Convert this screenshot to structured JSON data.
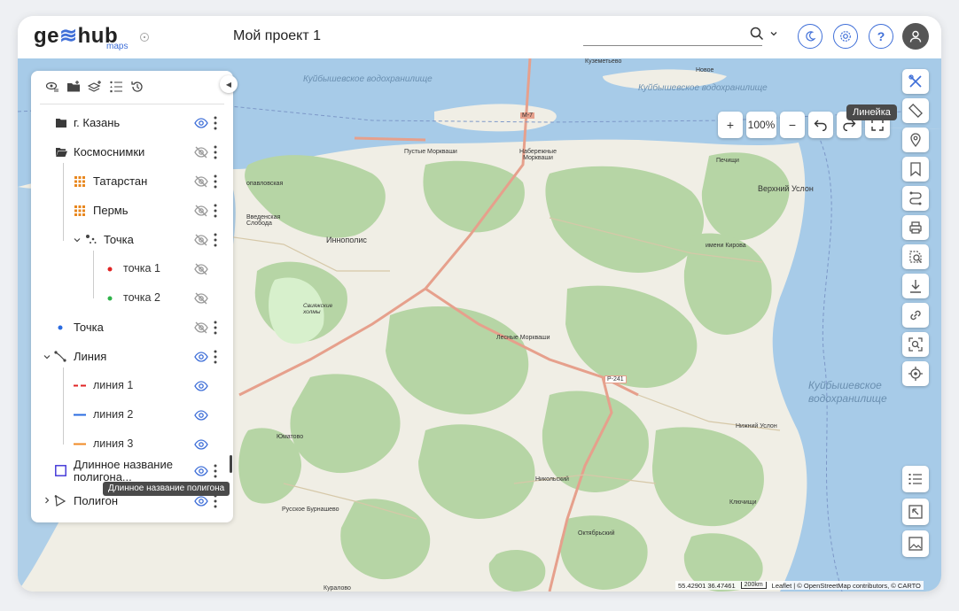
{
  "header": {
    "logo_text_1": "ge",
    "logo_text_2": "hub",
    "logo_sub": "maps",
    "project_title": "Мой проект 1",
    "search_placeholder": ""
  },
  "icons": {
    "search": "search-icon",
    "theme": "moon-icon",
    "settings": "gear-icon",
    "help": "question-icon",
    "user": "user-icon"
  },
  "colors": {
    "accent": "#3f6fd8",
    "eye_visible": "#3f6fd8",
    "eye_hidden": "#9a9a9a",
    "water": "#a7cbe8",
    "land": "#f0eee5",
    "forest": "#b6d5a5",
    "road_major": "#e6a08c"
  },
  "layers": [
    {
      "label": "г. Казань",
      "icon": "folder-closed-icon",
      "visible": true,
      "menu": true
    },
    {
      "label": "Космоснимки",
      "icon": "folder-open-icon",
      "visible": false,
      "menu": true
    },
    {
      "label": "Татарстан",
      "icon": "raster-grid-icon",
      "visible": false,
      "menu": true
    },
    {
      "label": "Пермь",
      "icon": "raster-grid-icon",
      "visible": false,
      "menu": true
    },
    {
      "label": "Точка",
      "icon": "points-group-icon",
      "visible": false,
      "menu": true
    },
    {
      "label": "точка 1",
      "icon": "red-dot-icon",
      "visible": false,
      "menu": false
    },
    {
      "label": "точка 2",
      "icon": "green-dot-icon",
      "visible": false,
      "menu": false
    },
    {
      "label": "Точка",
      "icon": "blue-dot-icon",
      "visible": false,
      "menu": true
    },
    {
      "label": "Линия",
      "icon": "line-icon",
      "visible": true,
      "menu": true
    },
    {
      "label": "линия 1",
      "icon": "red-dash-icon",
      "visible": true,
      "menu": false
    },
    {
      "label": "линия 2",
      "icon": "blue-line-icon",
      "visible": true,
      "menu": false
    },
    {
      "label": "линия 3",
      "icon": "orange-line-icon",
      "visible": true,
      "menu": false
    },
    {
      "label": "Длинное название",
      "label2": "полигона...",
      "icon": "polygon-square-icon",
      "visible": true,
      "menu": true
    },
    {
      "label": "Полигон",
      "icon": "polygon-icon",
      "visible": true,
      "menu": true
    }
  ],
  "tooltip_layer": "Длинное название полигона",
  "map_controls": {
    "zoom_in": "+",
    "zoom_level": "100%",
    "zoom_out": "−",
    "tooltip_ruler": "Линейка"
  },
  "map_labels": {
    "water1": "Куйбышевское водохранилище",
    "water2": "Куйбышевское водохранилище",
    "water3": "Куйбышевское водохранилище",
    "innopolis": "Иннополис",
    "verkhny_uslon": "Верхний Услон",
    "pustye_morkvashi": "Пустые Моркваши",
    "naberezhnye_morkvashi": "Набережные Моркваши",
    "vvedenskaya": "Введенская Слобода",
    "lesnye_morkvashi": "Лесные Моркваши",
    "imeni_kirova": "имени Кирова",
    "pechischi": "Печищи",
    "nizhny_uslon": "Нижний Услон",
    "yumatovo": "Юматово",
    "nikolsky": "Никольский",
    "klyuchischi": "Ключищи",
    "oktyabrsky": "Октябрьский",
    "russkoe_burnashevo": "Русское Бурнашево",
    "kuralovo": "Куралово",
    "kuzemetyevo": "Куземетьево",
    "novoe": "Новое",
    "sviyazhskie": "Свияжские холмы",
    "pavlovskaya": "опавловская",
    "m7": "М-7",
    "r241": "Р-241"
  },
  "attribution": {
    "coords": "55.42901 36.47461",
    "scale": "200km",
    "text": "Leaflet | © OpenStreetMap contributors, © CARTO"
  }
}
